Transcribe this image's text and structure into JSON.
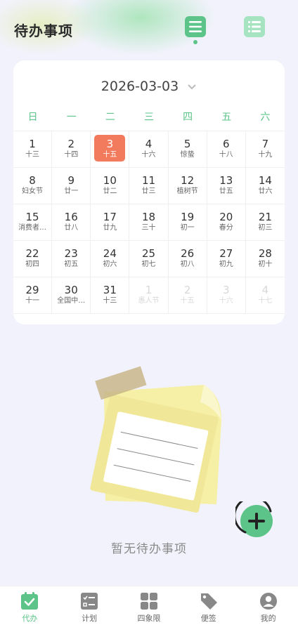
{
  "header": {
    "title": "待办事项"
  },
  "calendar": {
    "month_label": "2026-03-03",
    "weekdays": [
      "日",
      "一",
      "二",
      "三",
      "四",
      "五",
      "六"
    ],
    "days": [
      {
        "d": "1",
        "l": "十三"
      },
      {
        "d": "2",
        "l": "十四"
      },
      {
        "d": "3",
        "l": "十五",
        "today": true
      },
      {
        "d": "4",
        "l": "十六"
      },
      {
        "d": "5",
        "l": "惊蛰"
      },
      {
        "d": "6",
        "l": "十八"
      },
      {
        "d": "7",
        "l": "十九"
      },
      {
        "d": "8",
        "l": "妇女节"
      },
      {
        "d": "9",
        "l": "廿一"
      },
      {
        "d": "10",
        "l": "廿二"
      },
      {
        "d": "11",
        "l": "廿三"
      },
      {
        "d": "12",
        "l": "植树节"
      },
      {
        "d": "13",
        "l": "廿五"
      },
      {
        "d": "14",
        "l": "廿六"
      },
      {
        "d": "15",
        "l": "消费者…"
      },
      {
        "d": "16",
        "l": "廿八"
      },
      {
        "d": "17",
        "l": "廿九"
      },
      {
        "d": "18",
        "l": "三十"
      },
      {
        "d": "19",
        "l": "初一"
      },
      {
        "d": "20",
        "l": "春分"
      },
      {
        "d": "21",
        "l": "初三"
      },
      {
        "d": "22",
        "l": "初四"
      },
      {
        "d": "23",
        "l": "初五"
      },
      {
        "d": "24",
        "l": "初六"
      },
      {
        "d": "25",
        "l": "初七"
      },
      {
        "d": "26",
        "l": "初八"
      },
      {
        "d": "27",
        "l": "初九"
      },
      {
        "d": "28",
        "l": "初十"
      },
      {
        "d": "29",
        "l": "十一"
      },
      {
        "d": "30",
        "l": "全国中…"
      },
      {
        "d": "31",
        "l": "十三"
      },
      {
        "d": "1",
        "l": "愚人节",
        "muted": true
      },
      {
        "d": "2",
        "l": "十五",
        "muted": true
      },
      {
        "d": "3",
        "l": "十六",
        "muted": true
      },
      {
        "d": "4",
        "l": "十七",
        "muted": true
      }
    ]
  },
  "empty": {
    "text": "暂无待办事项"
  },
  "tabs": [
    {
      "label": "代办",
      "icon": "todo-check-icon",
      "active": true
    },
    {
      "label": "计划",
      "icon": "plan-list-icon"
    },
    {
      "label": "四象限",
      "icon": "quadrant-icon"
    },
    {
      "label": "便签",
      "icon": "tag-icon"
    },
    {
      "label": "我的",
      "icon": "user-icon"
    }
  ],
  "colors": {
    "accent": "#5cc488",
    "today": "#f37b5d"
  }
}
